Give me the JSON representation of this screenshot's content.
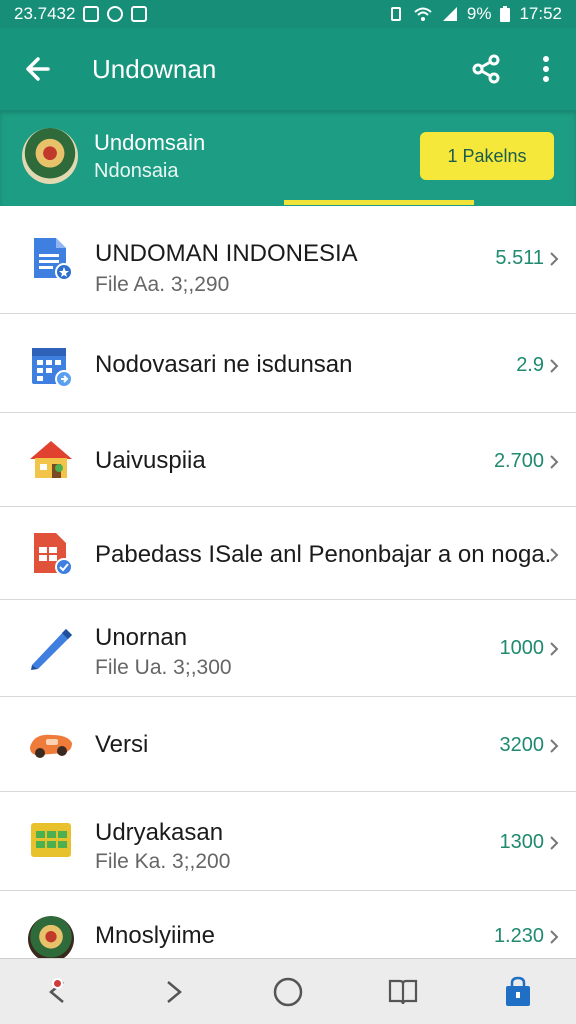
{
  "status_bar": {
    "left_text": "23.7432",
    "battery_pct": "9%",
    "time": "17:52"
  },
  "app_bar": {
    "title": "Undownan"
  },
  "header": {
    "line1": "Undomsain",
    "line2": "Ndonsaia",
    "package_label": "1 Pakelns"
  },
  "items": [
    {
      "title": "UNDOMAN INDONESIA",
      "subtitle": "File Aa. 3;,290",
      "value": "5.511"
    },
    {
      "title": "Nodovasari ne isdunsan",
      "subtitle": "",
      "value": "2.9"
    },
    {
      "title": "Uaivuspiia",
      "subtitle": "",
      "value": "2.700"
    },
    {
      "title": "Pabedass ISale anl Penonbajar a on noga.",
      "subtitle": "",
      "value": ""
    },
    {
      "title": "Unornan",
      "subtitle": "File Ua. 3;,300",
      "value": "1000"
    },
    {
      "title": "Versi",
      "subtitle": "",
      "value": "3200"
    },
    {
      "title": "Udryakasan",
      "subtitle": "File Ka. 3;,200",
      "value": "1300"
    },
    {
      "title": "Mnoslyiime",
      "subtitle": "",
      "value": "1.230"
    }
  ],
  "colors": {
    "primary": "#17957d",
    "accent": "#f5e83a",
    "value_text": "#1f8a6e"
  }
}
